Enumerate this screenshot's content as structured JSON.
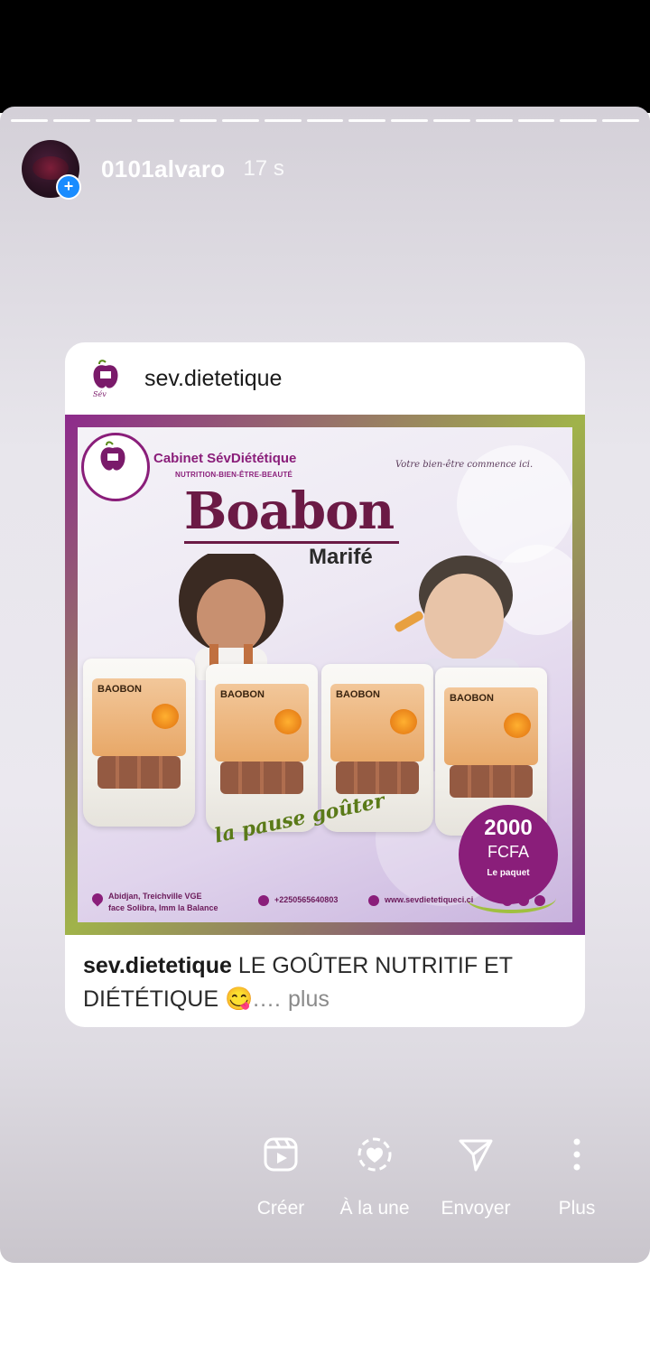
{
  "story": {
    "username": "0101alvaro",
    "time": "17 s",
    "progress_segments": 15
  },
  "post": {
    "author": "sev.dietetique",
    "caption_user": "sev.dietetique",
    "caption_text": " LE GOÛTER NUTRITIF ET DIÉTÉTIQUE 😋",
    "caption_more": ".… plus"
  },
  "flyer": {
    "cabinet": "Cabinet SévDiététique",
    "cabinet_sub": "NUTRITION-BIEN-ÊTRE-BEAUTÉ",
    "tagline": "Votre bien-être commence ici.",
    "title": "Boabon",
    "subtitle": "Marifé",
    "bag_label": "BAOBON",
    "slogan": "la pause goûter",
    "price_amount": "2000",
    "price_currency": "FCFA",
    "price_unit": "Le paquet",
    "address_line1": "Abidjan, Treichville VGE",
    "address_line2": "face Solibra, Imm la Balance",
    "phone": "+2250565640803",
    "website": "www.sevdietetiqueci.ci"
  },
  "actions": [
    {
      "label": "Créer",
      "icon": "reels-icon"
    },
    {
      "label": "À la une",
      "icon": "highlight-heart-icon"
    },
    {
      "label": "Envoyer",
      "icon": "send-icon"
    },
    {
      "label": "Plus",
      "icon": "more-vertical-icon"
    }
  ]
}
